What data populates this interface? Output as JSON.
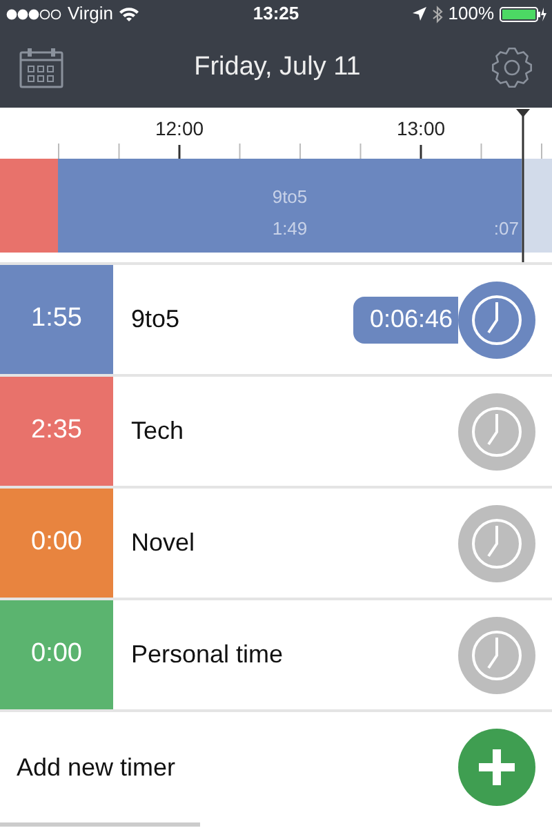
{
  "status_bar": {
    "carrier": "Virgin",
    "time": "13:25",
    "battery": "100%"
  },
  "header": {
    "title": "Friday, July 11"
  },
  "timeline": {
    "tick_labels": [
      "12:00",
      "13:00"
    ],
    "segments": [
      {
        "kind": "past",
        "color": "#e8726b"
      },
      {
        "kind": "current",
        "color": "#6b87bf",
        "name": "9to5",
        "duration": "1:49",
        "tail": ":07"
      },
      {
        "kind": "future",
        "color": "#d2dbea"
      }
    ]
  },
  "timers": [
    {
      "duration": "1:55",
      "name": "9to5",
      "color": "#6b87bf",
      "running": true,
      "elapsed": "0:06:46"
    },
    {
      "duration": "2:35",
      "name": "Tech",
      "color": "#e8726b",
      "running": false
    },
    {
      "duration": "0:00",
      "name": "Novel",
      "color": "#e8843f",
      "running": false
    },
    {
      "duration": "0:00",
      "name": "Personal time",
      "color": "#5bb46f",
      "running": false
    }
  ],
  "add_timer": {
    "label": "Add new timer"
  }
}
